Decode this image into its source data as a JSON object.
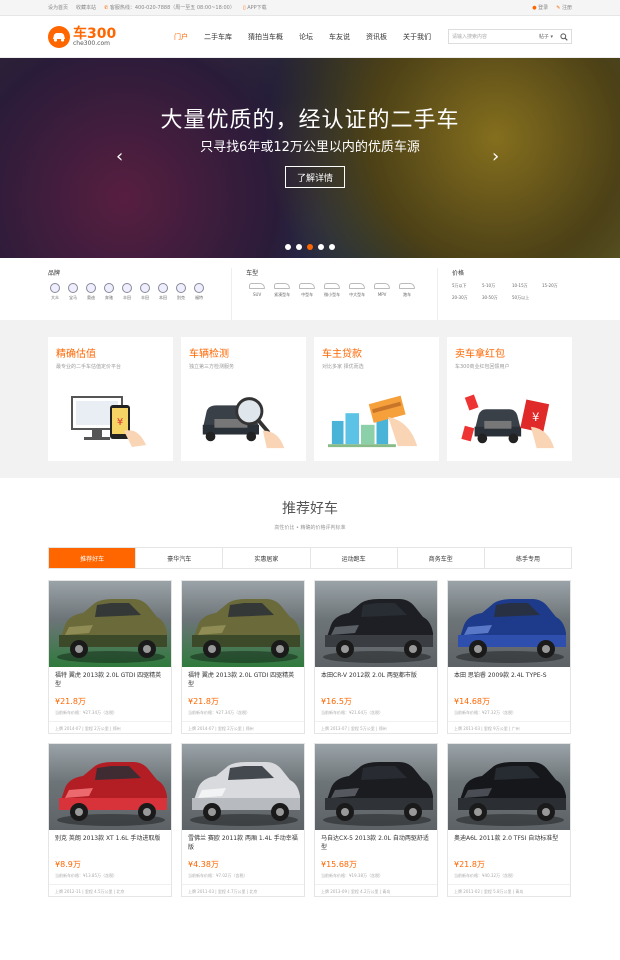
{
  "topbar": {
    "home": "设为首页",
    "favorite": "收藏本站",
    "hotline": "客服热线：400-020-7888（周一至五 08:00~18:00）",
    "app": "APP下载",
    "login": "登录",
    "register": "注册"
  },
  "header": {
    "logo_big": "车300",
    "logo_small": "che300.com",
    "nav": [
      "门户",
      "二手车库",
      "猜拍当车概",
      "论坛",
      "车友说",
      "资讯板",
      "关于我们"
    ],
    "search_placeholder": "请输入搜索内容",
    "search_select": "帖子"
  },
  "banner": {
    "headline": "大量优质的，经认证的二手车",
    "subline": "只寻找6年或12万公里以内的优质车源",
    "cta": "了解详情",
    "dots_active_index": 2
  },
  "filter": {
    "brand_title": "品牌",
    "brands": [
      "大众",
      "宝马",
      "奥迪",
      "奔驰",
      "丰田",
      "丰田",
      "本田",
      "别克",
      "福特"
    ],
    "type_title": "车型",
    "types": [
      "SUV",
      "紧凑型车",
      "中型车",
      "微小型车",
      "中大型车",
      "MPV",
      "跑车"
    ],
    "price_title": "价格",
    "prices": [
      "5万以下",
      "5-10万",
      "10-15万",
      "15-20万",
      "20-30万",
      "30-50万",
      "50万以上"
    ]
  },
  "services": [
    {
      "title": "精确估值",
      "subtitle": "最专业的二手车估值定价平台"
    },
    {
      "title": "车辆检测",
      "subtitle": "独立第三方检测服务"
    },
    {
      "title": "车主贷款",
      "subtitle": "对比多家 择优而选"
    },
    {
      "title": "卖车拿红包",
      "subtitle": "车300商业红包回馈用户"
    }
  ],
  "recommend": {
    "title": "推荐好车",
    "subtitle": "高性价比 • 精确的价格评判标准",
    "tabs": [
      "推荐好车",
      "豪华汽车",
      "实惠居家",
      "运动跑车",
      "商务车型",
      "练手专用"
    ],
    "active_tab": 0,
    "cars": [
      {
        "name": "福特 翼虎 2013款 2.0L GTDI 四驱精英型",
        "price": "¥21.8万",
        "newprice": "当前新车价格：¥27.34万（含税）",
        "meta": "上牌 2014-07 | 里程 2万公里 | 郑州"
      },
      {
        "name": "福特 翼虎 2013款 2.0L GTDI 四驱精英型",
        "price": "¥21.8万",
        "newprice": "当前新车价格：¥27.34万（含税）",
        "meta": "上牌 2014-07 | 里程 2万公里 | 郑州"
      },
      {
        "name": "本田CR-V 2012款 2.0L 两驱都市版",
        "price": "¥16.5万",
        "newprice": "当前新车价格：¥21.64万（含税）",
        "meta": "上牌 2013-07 | 里程 5万公里 | 郑州"
      },
      {
        "name": "本田 思铂睿 2009款 2.4L TYPE-S",
        "price": "¥14.68万",
        "newprice": "当前新车价格：¥27.32万（含税）",
        "meta": "上牌 2011-03 | 里程 9万公里 | 广州"
      },
      {
        "name": "别克 英朗 2013款 XT 1.6L 手动进取版",
        "price": "¥8.9万",
        "newprice": "当前新车价格：¥13.85万（含税）",
        "meta": "上牌 2012-11 | 里程 4.5万公里 | 北京"
      },
      {
        "name": "雪佛兰 赛欧 2011款 两厢 1.4L 手动幸福版",
        "price": "¥4.38万",
        "newprice": "当前新车价格：¥7.02万（含税）",
        "meta": "上牌 2011-03 | 里程 4.7万公里 | 北京"
      },
      {
        "name": "马自达CX-5 2013款 2.0L 自动两驱舒适型",
        "price": "¥15.68万",
        "newprice": "当前新车价格：¥19.38万（含税）",
        "meta": "上牌 2013-09 | 里程 4.2万公里 | 青岛"
      },
      {
        "name": "奥迪A6L 2011款 2.0 TFSI 自动标准型",
        "price": "¥21.8万",
        "newprice": "当前新车价格：¥40.32万（含税）",
        "meta": "上牌 2011-02 | 里程 5.8万公里 | 青岛"
      }
    ]
  },
  "colors": {
    "accent": "#ff6600"
  }
}
